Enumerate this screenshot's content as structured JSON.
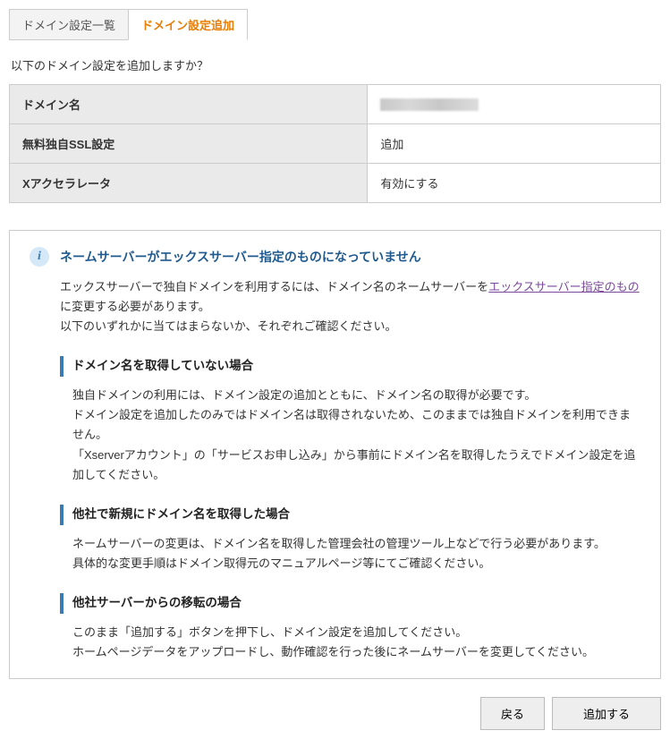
{
  "tabs": {
    "list": "ドメイン設定一覧",
    "add": "ドメイン設定追加"
  },
  "prompt": "以下のドメイン設定を追加しますか？",
  "table": {
    "rows": [
      {
        "label": "ドメイン名",
        "value": ""
      },
      {
        "label": "無料独自SSL設定",
        "value": "追加"
      },
      {
        "label": "Xアクセラレータ",
        "value": "有効にする"
      }
    ]
  },
  "info": {
    "title": "ネームサーバーがエックスサーバー指定のものになっていません",
    "p1a": "エックスサーバーで独自ドメインを利用するには、ドメイン名のネームサーバーを",
    "p1link": "エックスサーバー指定のもの",
    "p1b": "に変更する必要があります。",
    "p2": "以下のいずれかに当てはまらないか、それぞれご確認ください。",
    "sections": [
      {
        "title": "ドメイン名を取得していない場合",
        "lines": [
          "独自ドメインの利用には、ドメイン設定の追加とともに、ドメイン名の取得が必要です。",
          "ドメイン設定を追加したのみではドメイン名は取得されないため、このままでは独自ドメインを利用できません。",
          "「Xserverアカウント」の「サービスお申し込み」から事前にドメイン名を取得したうえでドメイン設定を追加してください。"
        ]
      },
      {
        "title": "他社で新規にドメイン名を取得した場合",
        "lines": [
          "ネームサーバーの変更は、ドメイン名を取得した管理会社の管理ツール上などで行う必要があります。",
          "具体的な変更手順はドメイン取得元のマニュアルページ等にてご確認ください。"
        ]
      },
      {
        "title": "他社サーバーからの移転の場合",
        "lines": [
          "このまま「追加する」ボタンを押下し、ドメイン設定を追加してください。",
          "ホームページデータをアップロードし、動作確認を行った後にネームサーバーを変更してください。"
        ]
      }
    ]
  },
  "buttons": {
    "back": "戻る",
    "submit": "追加する"
  }
}
